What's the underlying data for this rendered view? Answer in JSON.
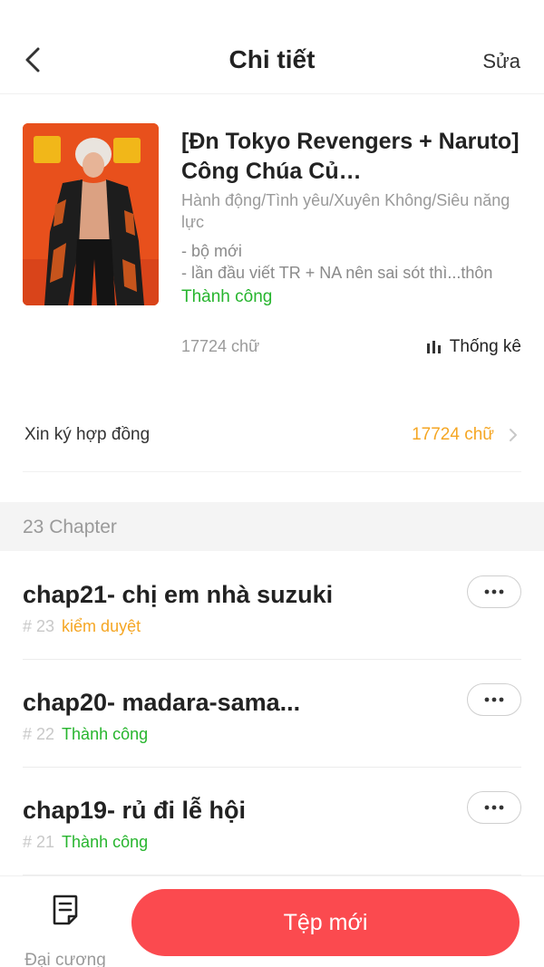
{
  "header": {
    "title": "Chi tiết",
    "edit_label": "Sửa",
    "back_icon": "chevron-left-icon"
  },
  "book": {
    "title": "[Đn Tokyo Revengers + Naruto] Công Chúa Củ…",
    "genres": "Hành động/Tình yêu/Xuyên Không/Siêu năng lực",
    "description_lines": [
      "- bộ mới",
      "- lần đầu viết TR + NA nên sai sót thì...thôn"
    ],
    "status": "Thành công",
    "word_count": "17724 chữ",
    "stats_label": "Thống kê",
    "stats_icon": "bar-chart-icon"
  },
  "contract": {
    "label": "Xin ký hợp đồng",
    "value": "17724 chữ"
  },
  "chapters_section": {
    "title": "23 Chapter"
  },
  "chapters": [
    {
      "title": "chap21- chị em nhà suzuki",
      "number": "# 23",
      "status": "kiểm duyệt"
    },
    {
      "title": "chap20- madara-sama...",
      "number": "# 22",
      "status": "Thành công"
    },
    {
      "title": "chap19- rủ đi lễ hội",
      "number": "# 21",
      "status": "Thành công"
    }
  ],
  "bottom_bar": {
    "outline_label": "Đại cương",
    "new_file_label": "Tệp mới"
  },
  "colors": {
    "accent_red": "#fb4a4f",
    "success_green": "#27b52e",
    "review_orange": "#f5a623",
    "cover_bg": "#e8501c"
  }
}
